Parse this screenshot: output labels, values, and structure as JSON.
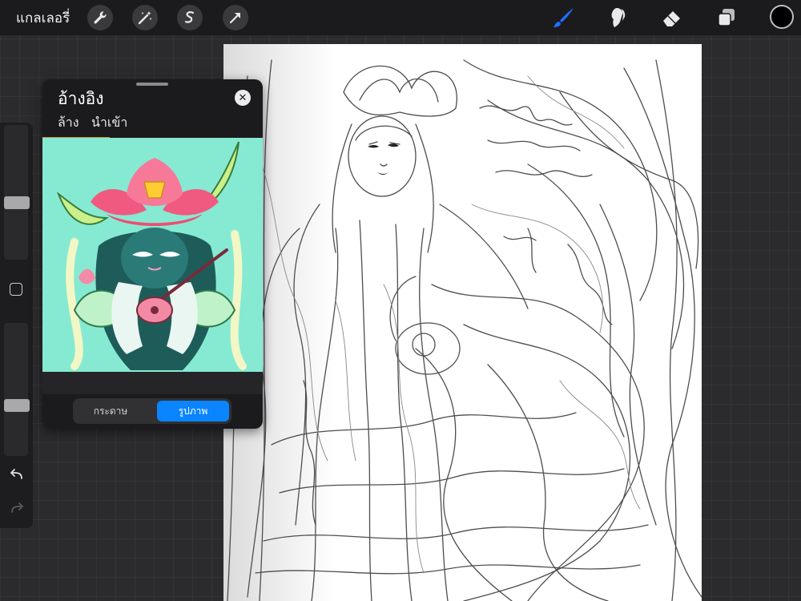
{
  "topbar": {
    "gallery_label": "แกลเลอรี่",
    "tools_left": [
      "wrench-icon",
      "magic-wand-icon",
      "selection-icon",
      "transform-arrow-icon"
    ],
    "tools_right": [
      "brush-icon",
      "smudge-icon",
      "eraser-icon",
      "layers-icon"
    ],
    "active_tool": "brush-icon",
    "accent_color": "#1e6fff",
    "current_color": "#000000"
  },
  "sidebar": {
    "size_slider_level": 0.55,
    "opacity_slider_level": 0.35,
    "undo_icon": "undo-icon",
    "redo_icon": "redo-icon"
  },
  "reference": {
    "title": "อ้างอิง",
    "clear_label": "ล้าง",
    "import_label": "นำเข้า",
    "close_icon": "close-icon",
    "modes": [
      "กระดาษ",
      "รูปภาพ"
    ],
    "active_mode": "รูปภาพ",
    "image_background": "#86ead2"
  }
}
